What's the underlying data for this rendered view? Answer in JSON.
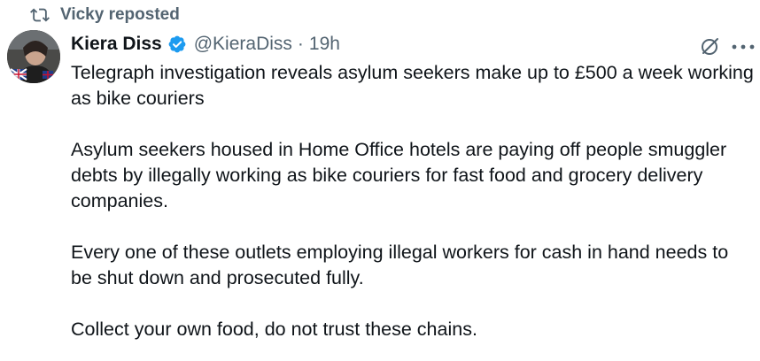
{
  "repost": {
    "text": "Vicky reposted"
  },
  "author": {
    "display_name": "Kiera Diss",
    "handle": "@KieraDiss",
    "separator": "·",
    "time": "19h",
    "verified": true
  },
  "tweet": {
    "paragraphs": [
      "Telegraph investigation reveals asylum seekers make up to £500 a week working as bike couriers",
      "Asylum seekers housed in Home Office hotels are paying off people smuggler debts by illegally working as bike couriers for fast food and grocery delivery companies.",
      "Every one of these outlets employing illegal workers for cash in hand needs to be shut down and prosecuted fully.",
      "Collect your own food, do not trust these chains."
    ]
  },
  "icons": {
    "repost": "repost-icon",
    "verified": "verified-badge-icon",
    "grok": "grok-icon",
    "more": "more-options-icon"
  },
  "colors": {
    "text_primary": "#0f1419",
    "text_secondary": "#536471",
    "verified_blue": "#1d9bf0"
  }
}
